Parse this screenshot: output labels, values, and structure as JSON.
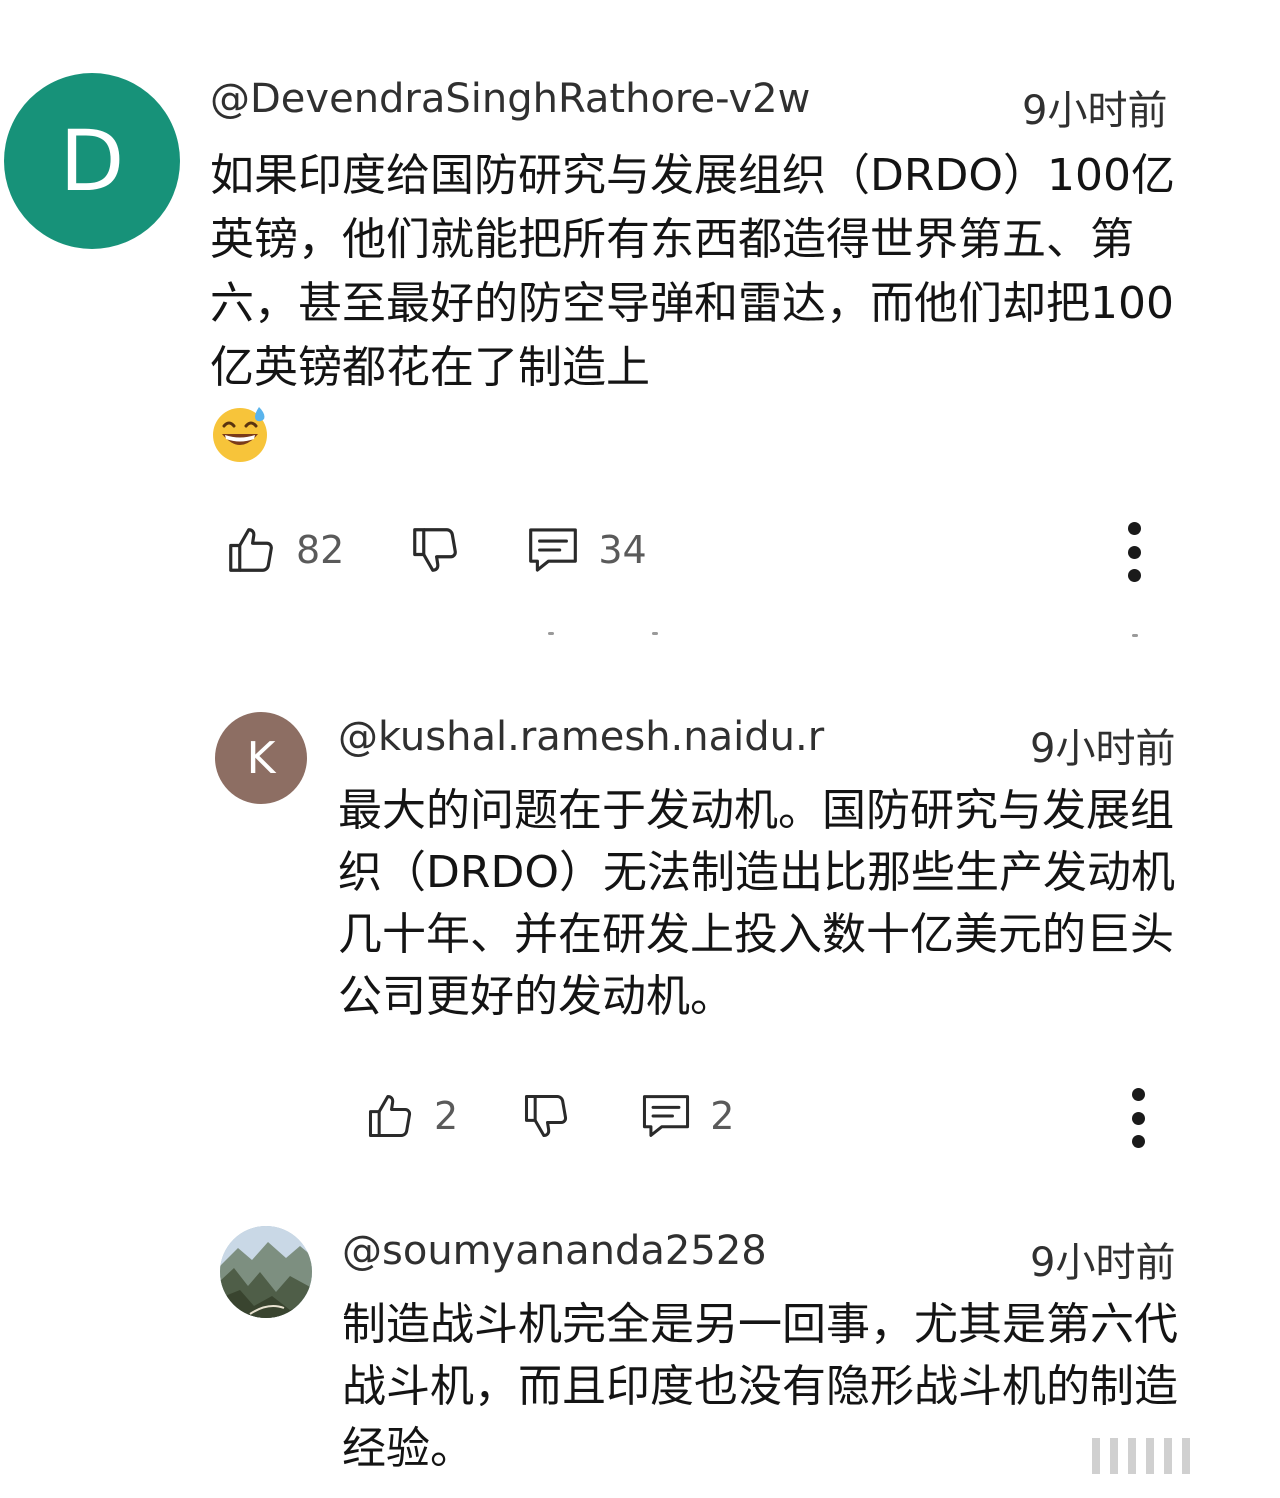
{
  "comments": [
    {
      "avatar_letter": "D",
      "avatar_color": "#179279",
      "author": "@DevendraSinghRathore-v2w",
      "time": "9小时前",
      "text": "如果印度给国防研究与发展组织（DRDO）100亿英镑，他们就能把所有东西都造得世界第五、第六，甚至最好的防空导弹和雷达，而他们却把100亿英镑都花在了制造上",
      "emoji": "grinning-face-with-sweat",
      "likes": "82",
      "replies": "34"
    },
    {
      "avatar_letter": "K",
      "avatar_color": "#8d6e63",
      "author": "@kushal.ramesh.naidu.r",
      "time": "9小时前",
      "text": "最大的问题在于发动机。国防研究与发展组织（DRDO）无法制造出比那些生产发动机几十年、并在研发上投入数十亿美元的巨头公司更好的发动机。",
      "likes": "2",
      "replies": "2"
    },
    {
      "avatar_image": "mountain-landscape-photo",
      "author": "@soumyananda2528",
      "time": "9小时前",
      "text": "制造战斗机完全是另一回事，尤其是第六代战斗机，而且印度也没有隐形战斗机的制造经验。"
    }
  ],
  "icons": {
    "like": "thumbs-up-icon",
    "dislike": "thumbs-down-icon",
    "reply": "comment-icon",
    "more": "more-vertical-icon"
  }
}
